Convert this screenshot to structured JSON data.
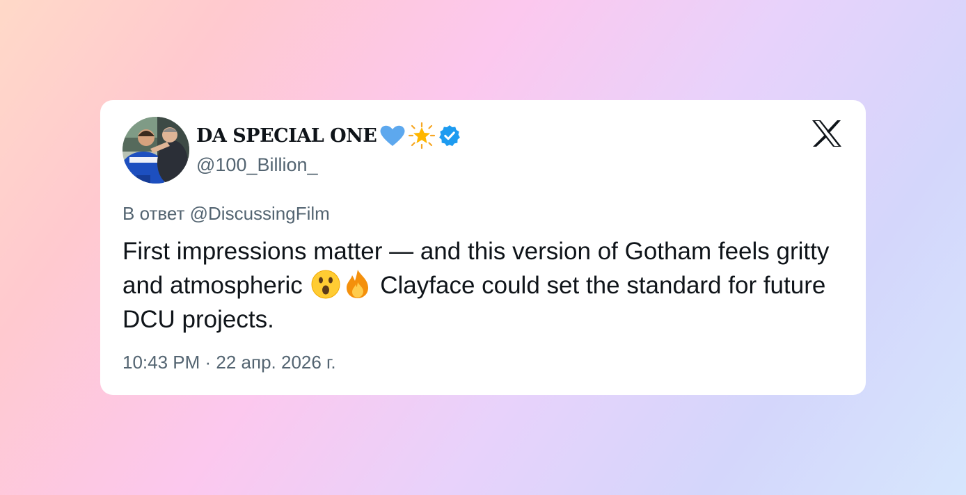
{
  "tweet": {
    "display_name": "DA SPECIAL ONE",
    "name_emojis": [
      "blue-heart-icon",
      "glowing-star-icon"
    ],
    "verified": true,
    "handle": "@100_Billion_",
    "reply_prefix": "В ответ",
    "reply_to": "@DiscussingFilm",
    "text_part1": "First impressions matter — and this version of Gotham feels gritty and atmospheric",
    "text_part2": "Clayface could set the standard for future DCU projects.",
    "inline_emojis": [
      "surprised-face-icon",
      "fire-icon"
    ],
    "timestamp": "10:43 PM · 22 апр. 2026 г."
  },
  "colors": {
    "text_primary": "#0f1419",
    "text_secondary": "#536471",
    "verified_blue": "#1d9bf0",
    "heart_blue": "#5da8ee",
    "card_bg": "#ffffff"
  },
  "platform_logo": "x-logo-icon"
}
